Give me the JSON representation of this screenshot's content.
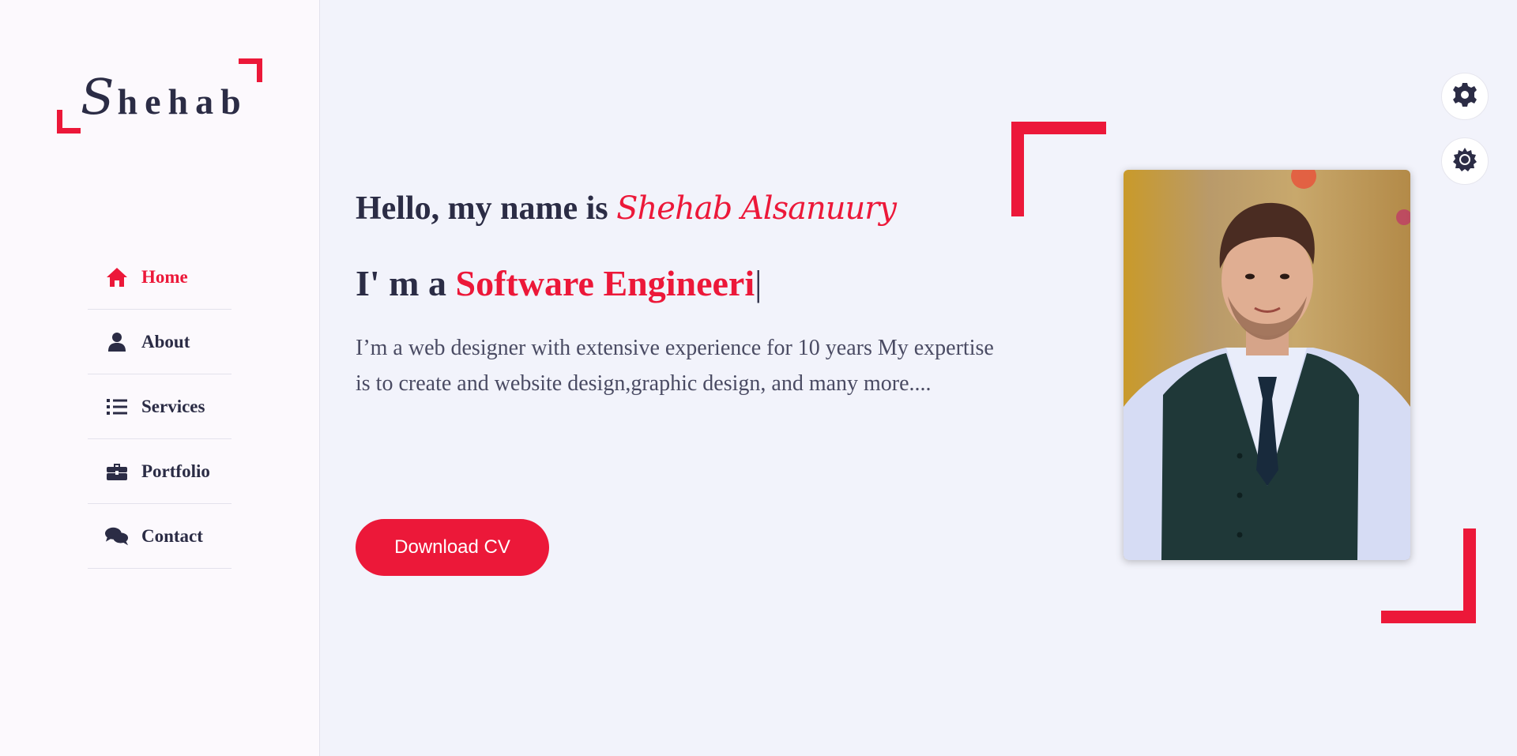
{
  "logo": {
    "first_letter": "S",
    "rest": "hehab"
  },
  "nav": {
    "items": [
      {
        "label": "Home",
        "icon": "home-icon",
        "active": true
      },
      {
        "label": "About",
        "icon": "user-icon",
        "active": false
      },
      {
        "label": "Services",
        "icon": "list-icon",
        "active": false
      },
      {
        "label": "Portfolio",
        "icon": "briefcase-icon",
        "active": false
      },
      {
        "label": "Contact",
        "icon": "comments-icon",
        "active": false
      }
    ]
  },
  "hero": {
    "greeting_prefix": "Hello, my name is",
    "name": "Shehab Alsanuury",
    "role_prefix": "I' m a",
    "role_typed": "Software Engineeri",
    "caret": "|",
    "description": "I’m a web designer with extensive experience for 10 years My expertise is to create and website design,graphic design, and many more....",
    "button_label": "Download CV"
  },
  "style_switcher": {
    "settings_icon": "gear-icon",
    "theme_icon": "sun-icon"
  },
  "colors": {
    "accent": "#ec1839",
    "text": "#2b2c45",
    "background": "#f2f3fb",
    "sidebar": "#fcf9fd"
  }
}
